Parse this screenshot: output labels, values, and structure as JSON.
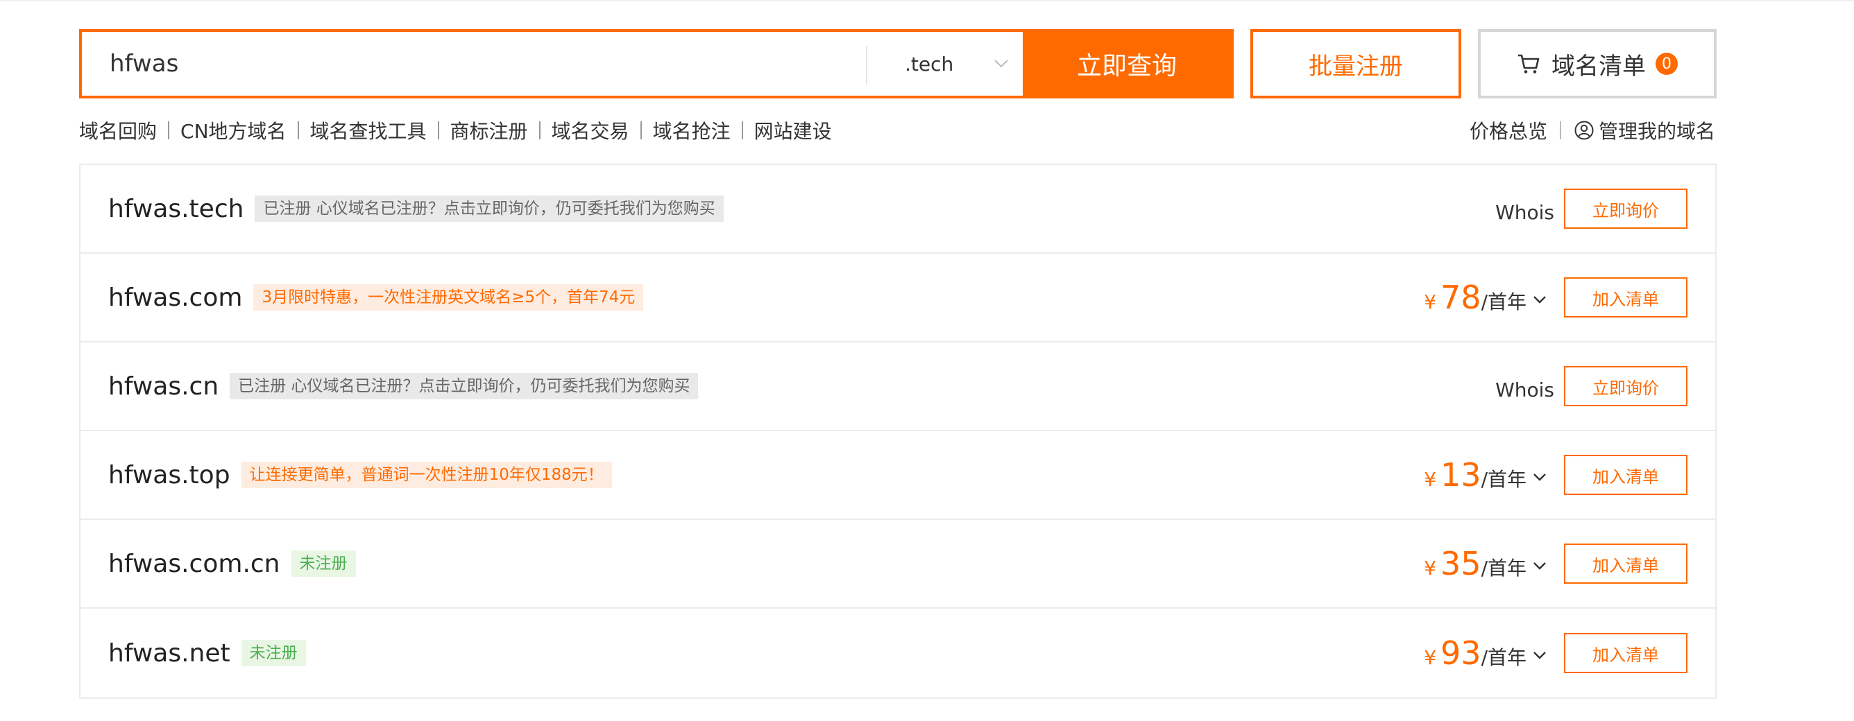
{
  "search": {
    "query": "hfwas",
    "tld": ".tech",
    "query_button": "立即查询",
    "batch_button": "批量注册",
    "cart_label": "域名清单",
    "cart_count": "0"
  },
  "subnav": [
    "域名回购",
    "CN地方域名",
    "域名查找工具",
    "商标注册",
    "域名交易",
    "域名抢注",
    "网站建设"
  ],
  "rightnav": {
    "price_overview": "价格总览",
    "manage": "管理我的域名"
  },
  "colors": {
    "accent": "#ff6a00",
    "registered_tag_bg": "#e9e9e9",
    "promo_tag_bg": "#ffece0",
    "available_tag_bg": "#e9f6e4",
    "available_text": "#4caf50"
  },
  "results": [
    {
      "domain": "hfwas.tech",
      "tag_type": "registered",
      "tag": "已注册 心仪域名已注册？点击立即询价，仍可委托我们为您购买",
      "whois": "Whois",
      "button": "立即询价"
    },
    {
      "domain": "hfwas.com",
      "tag_type": "promo",
      "tag": "3月限时特惠，一次性注册英文域名≥5个，首年74元",
      "currency": "¥",
      "price": "78",
      "unit": "/首年",
      "button": "加入清单"
    },
    {
      "domain": "hfwas.cn",
      "tag_type": "registered",
      "tag": "已注册 心仪域名已注册？点击立即询价，仍可委托我们为您购买",
      "whois": "Whois",
      "button": "立即询价"
    },
    {
      "domain": "hfwas.top",
      "tag_type": "promo",
      "tag": "让连接更简单，普通词一次性注册10年仅188元！",
      "currency": "¥",
      "price": "13",
      "unit": "/首年",
      "button": "加入清单"
    },
    {
      "domain": "hfwas.com.cn",
      "tag_type": "available",
      "tag": "未注册",
      "currency": "¥",
      "price": "35",
      "unit": "/首年",
      "button": "加入清单"
    },
    {
      "domain": "hfwas.net",
      "tag_type": "available",
      "tag": "未注册",
      "currency": "¥",
      "price": "93",
      "unit": "/首年",
      "button": "加入清单"
    }
  ]
}
